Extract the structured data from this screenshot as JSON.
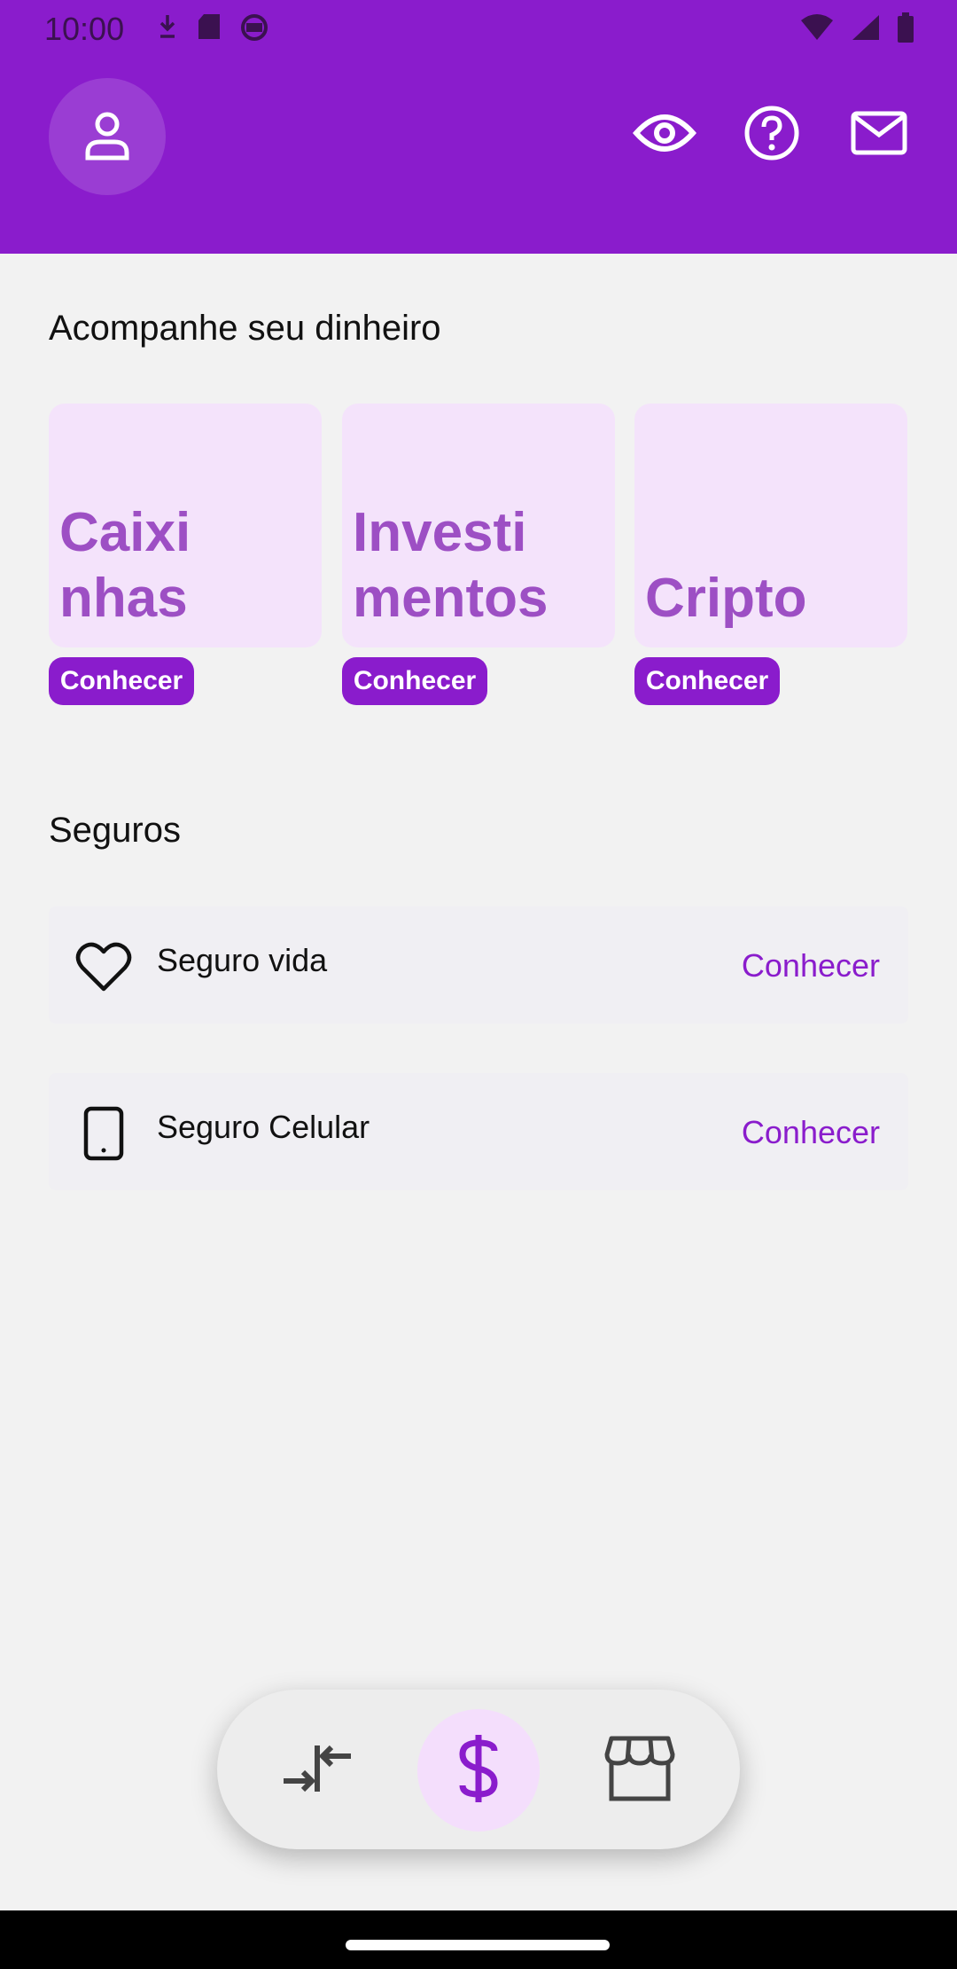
{
  "status_bar": {
    "time": "10:00",
    "icons_left": [
      "download-icon",
      "sd-card-icon",
      "android-icon"
    ],
    "icons_right": [
      "wifi-icon",
      "signal-icon",
      "battery-icon"
    ]
  },
  "header": {
    "background": "#8a1ccc",
    "buttons": [
      "profile-icon",
      "eye-icon",
      "help-icon",
      "mail-icon"
    ]
  },
  "money_section": {
    "title": "Acompanhe seu dinheiro",
    "cards": [
      {
        "label": "Caixi\nnhas",
        "action": "Conhecer"
      },
      {
        "label": "Investi\nmentos",
        "action": "Conhecer"
      },
      {
        "label": "Cripto",
        "action": "Conhecer"
      }
    ]
  },
  "insurance_section": {
    "title": "Seguros",
    "items": [
      {
        "icon": "heart-icon",
        "label": "Seguro vida",
        "action": "Conhecer"
      },
      {
        "icon": "phone-icon",
        "label": "Seguro Celular",
        "action": "Conhecer"
      }
    ]
  },
  "bottom_nav": {
    "items": [
      {
        "icon": "transfer-icon",
        "active": false
      },
      {
        "icon": "dollar-icon",
        "active": true
      },
      {
        "icon": "store-icon",
        "active": false
      }
    ],
    "active_color": "#8a1ccc"
  }
}
